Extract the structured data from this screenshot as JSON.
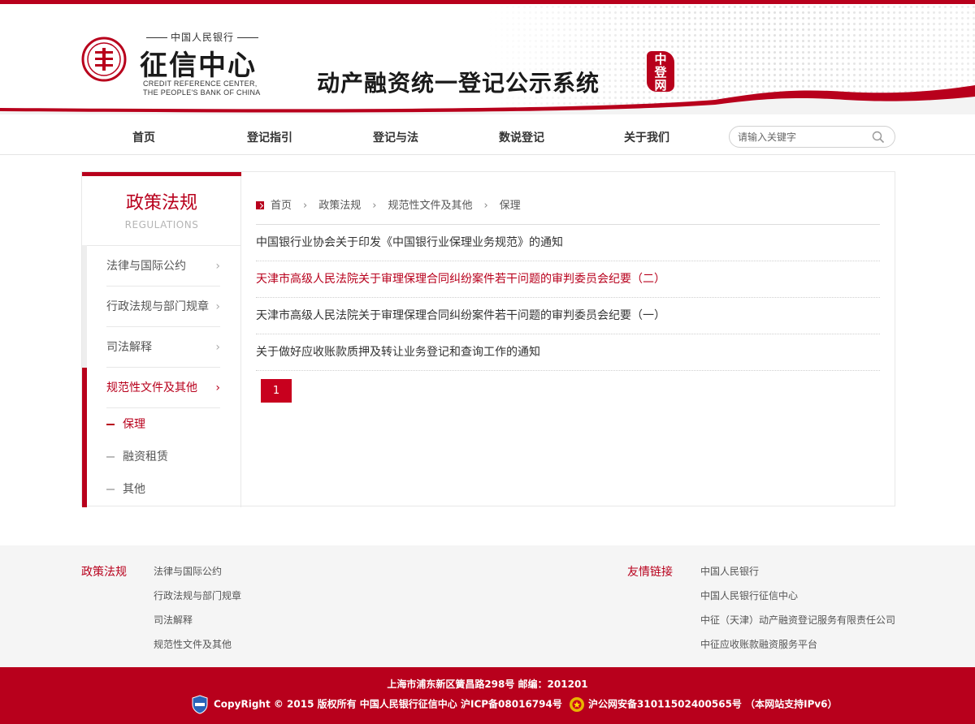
{
  "header": {
    "logo_top": "中国人民银行",
    "logo_main": "征信中心",
    "logo_en_line1": "CREDIT REFERENCE CENTER,",
    "logo_en_line2": "THE PEOPLE'S BANK OF CHINA",
    "system_title": "动产融资统一登记公示系统",
    "seal_text": "中登网",
    "colors": {
      "brand": "#b8001c"
    }
  },
  "nav": {
    "items": [
      "首页",
      "登记指引",
      "登记与法",
      "数说登记",
      "关于我们"
    ],
    "search_placeholder": "请输入关键字"
  },
  "sidebar": {
    "title": "政策法规",
    "subtitle": "REGULATIONS",
    "items": [
      {
        "label": "法律与国际公约"
      },
      {
        "label": "行政法规与部门规章"
      },
      {
        "label": "司法解释"
      },
      {
        "label": "规范性文件及其他",
        "active": true
      }
    ],
    "sub_items": [
      {
        "label": "保理",
        "active": true
      },
      {
        "label": "融资租赁"
      },
      {
        "label": "其他"
      }
    ]
  },
  "breadcrumb": [
    "首页",
    "政策法规",
    "规范性文件及其他",
    "保理"
  ],
  "articles": [
    "中国银行业协会关于印发《中国银行业保理业务规范》的通知",
    "天津市高级人民法院关于审理保理合同纠纷案件若干问题的审判委员会纪要（二）",
    "天津市高级人民法院关于审理保理合同纠纷案件若干问题的审判委员会纪要（一）",
    "关于做好应收账款质押及转让业务登记和查询工作的通知"
  ],
  "pagination": {
    "current": "1"
  },
  "footer": {
    "policy_title": "政策法规",
    "policy_links": [
      "法律与国际公约",
      "行政法规与部门规章",
      "司法解释",
      "规范性文件及其他"
    ],
    "friend_title": "友情链接",
    "friend_links": [
      "中国人民银行",
      "中国人民银行征信中心",
      "中征（天津）动产融资登记服务有限责任公司",
      "中征应收账款融资服务平台"
    ]
  },
  "bottom": {
    "address": "上海市浦东新区簧昌路298号 邮编：201201",
    "copyright": "CopyRight © 2015 版权所有 中国人民银行征信中心 沪ICP备08016794号",
    "police_record": "沪公网安备31011502400565号  （本网站支持IPv6）"
  }
}
